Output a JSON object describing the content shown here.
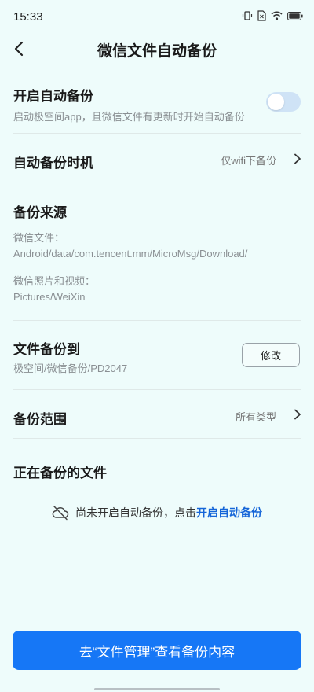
{
  "status_bar": {
    "time": "15:33"
  },
  "header": {
    "title": "微信文件自动备份"
  },
  "auto_backup": {
    "title": "开启自动备份",
    "description": "启动极空间app，且微信文件有更新时开始自动备份",
    "enabled": false
  },
  "backup_timing": {
    "label": "自动备份时机",
    "value": "仅wifi下备份"
  },
  "backup_source": {
    "title": "备份来源",
    "wechat_files_label": "微信文件：",
    "wechat_files_path": "Android/data/com.tencent.mm/MicroMsg/Download/",
    "wechat_media_label": "微信照片和视频：",
    "wechat_media_path": "Pictures/WeiXin"
  },
  "backup_destination": {
    "title": "文件备份到",
    "path": "极空间/微信备份/PD2047",
    "edit_label": "修改"
  },
  "backup_scope": {
    "label": "备份范围",
    "value": "所有类型"
  },
  "in_progress": {
    "title": "正在备份的文件",
    "empty_text": "尚未开启自动备份，点击",
    "empty_link": "开启自动备份"
  },
  "bottom_button": {
    "label": "去“文件管理”查看备份内容"
  },
  "colors": {
    "background": "#eefcfb",
    "accent": "#1677f6",
    "link": "#1565d8",
    "toggle_off": "#cfe3f6"
  }
}
